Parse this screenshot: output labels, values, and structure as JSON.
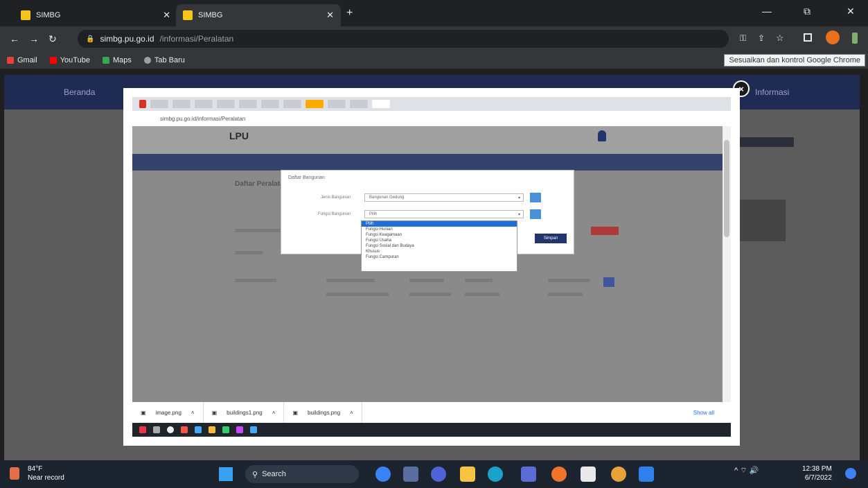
{
  "outer_browser": {
    "tabs": [
      {
        "label": "SIMBG"
      },
      {
        "label": "SIMBG"
      }
    ],
    "new_tab": "+",
    "window_controls": [
      "—",
      "⧉",
      "✕"
    ],
    "url_host": "simbg.pu.go.id",
    "url_path": "/informasi/Peralatan",
    "bookmarks": [
      "Gmail",
      "YouTube",
      "Maps",
      "Tab Baru"
    ],
    "tooltip": "Sesuaikan dan kontrol Google Chrome"
  },
  "background_page": {
    "nav_left": "Beranda",
    "nav_right": "Informasi"
  },
  "lightbox": {
    "close": "×",
    "inner_url": "simbg.pu.go.id/informasi/Peralatan",
    "inner_logo": "LPU",
    "page_title": "Daftar Peralatan",
    "modal": {
      "title": "Daftar Bangunan",
      "row1_label": "Jenis Bangunan",
      "row1_value": "Bangunan Gedung",
      "row2_label": "Fungsi Bangunan",
      "row2_value": "Pilih",
      "submit": "Simpan",
      "options": [
        "Pilih",
        "Fungsi Hunian",
        "Fungsi Keagamaan",
        "Fungsi Usaha",
        "Fungsi Sosial dan Budaya",
        "Khusus",
        "Fungsi Campuran"
      ],
      "selected_index": 0
    },
    "downloads": [
      {
        "name": "image.png"
      },
      {
        "name": "buildings1.png"
      },
      {
        "name": "buildings.png"
      }
    ],
    "show_all": "Show all"
  },
  "taskbar": {
    "weather_temp": "84°F",
    "weather_desc": "Near record",
    "search": "Search",
    "tray": "^  ⌔  🔊",
    "time": "12:38 PM",
    "date": "6/7/2022"
  },
  "colors": {
    "chrome_dark": "#202124",
    "page_nav": "#1f2b53",
    "submit_blue": "#22346e",
    "selected_option": "#1e6fd9",
    "add_button": "#4a90d9"
  }
}
